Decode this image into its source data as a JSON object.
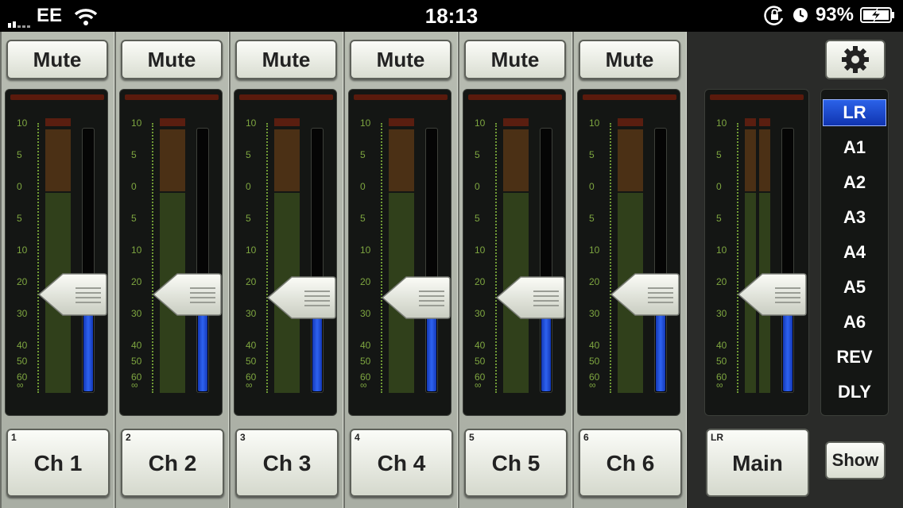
{
  "status": {
    "carrier": "EE",
    "time": "18:13",
    "battery": "93%"
  },
  "scale_labels": [
    "10",
    "5",
    "0",
    "5",
    "10",
    "20",
    "30",
    "40",
    "50",
    "60",
    "∞"
  ],
  "channels": [
    {
      "mute": "Mute",
      "number": "1",
      "name": "Ch 1",
      "fader_level": 0.37
    },
    {
      "mute": "Mute",
      "number": "2",
      "name": "Ch 2",
      "fader_level": 0.37
    },
    {
      "mute": "Mute",
      "number": "3",
      "name": "Ch 3",
      "fader_level": 0.36
    },
    {
      "mute": "Mute",
      "number": "4",
      "name": "Ch 4",
      "fader_level": 0.36
    },
    {
      "mute": "Mute",
      "number": "5",
      "name": "Ch 5",
      "fader_level": 0.36
    },
    {
      "mute": "Mute",
      "number": "6",
      "name": "Ch 6",
      "fader_level": 0.37
    }
  ],
  "master": {
    "number": "LR",
    "name": "Main",
    "fader_level": 0.37,
    "show": "Show"
  },
  "bus_list": [
    "LR",
    "A1",
    "A2",
    "A3",
    "A4",
    "A5",
    "A6",
    "REV",
    "DLY"
  ],
  "bus_selected": "LR",
  "colors": {
    "fader_blue": "#2e62f0",
    "meter_green": "#30401b",
    "scale_green": "#7ea640"
  }
}
